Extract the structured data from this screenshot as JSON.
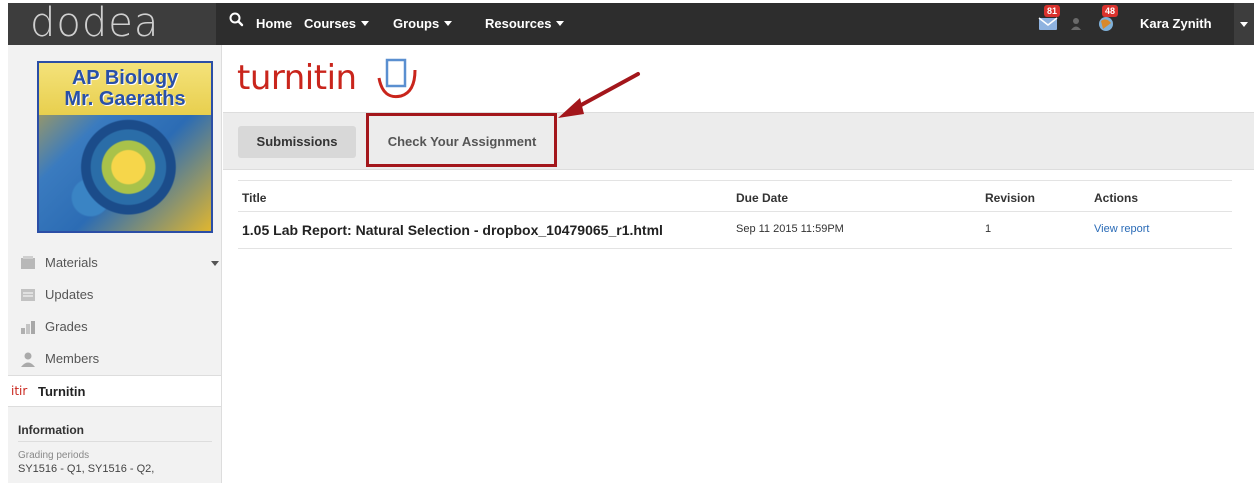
{
  "header": {
    "logo_text": "dodea",
    "nav": [
      {
        "label": "Home",
        "has_caret": false
      },
      {
        "label": "Courses",
        "has_caret": true
      },
      {
        "label": "Groups",
        "has_caret": true
      },
      {
        "label": "Resources",
        "has_caret": true
      }
    ],
    "messages_count": "81",
    "notifications_count": "48",
    "user_name": "Kara Zynith"
  },
  "course": {
    "title_line1": "AP Biology",
    "title_line2": "Mr. Gaeraths"
  },
  "sidebar": {
    "items": [
      {
        "label": "Materials",
        "icon": "materials-icon"
      },
      {
        "label": "Updates",
        "icon": "updates-icon"
      },
      {
        "label": "Grades",
        "icon": "grades-icon"
      },
      {
        "label": "Members",
        "icon": "members-icon"
      },
      {
        "label": "Turnitin",
        "icon": "turnitin-icon",
        "icon_text": "itir",
        "active": true
      }
    ],
    "info": {
      "heading": "Information",
      "small_label": "Grading periods",
      "text": "SY1516 - Q1, SY1516 - Q2,"
    }
  },
  "main": {
    "logo_text": "turnitin",
    "tabs": [
      {
        "label": "Submissions",
        "active": true
      },
      {
        "label": "Check Your Assignment",
        "active": false
      }
    ],
    "table": {
      "columns": [
        "Title",
        "Due Date",
        "Revision",
        "Actions"
      ],
      "rows": [
        {
          "title": "1.05 Lab Report: Natural Selection - dropbox_10479065_r1.html",
          "due_date": "Sep 11 2015 11:59PM",
          "revision": "1",
          "action": "View report"
        }
      ]
    }
  },
  "colors": {
    "topbar": "#2d2d2d",
    "turnitin_red": "#c9251c",
    "highlight": "#a3161b",
    "link": "#2a6bb7"
  }
}
